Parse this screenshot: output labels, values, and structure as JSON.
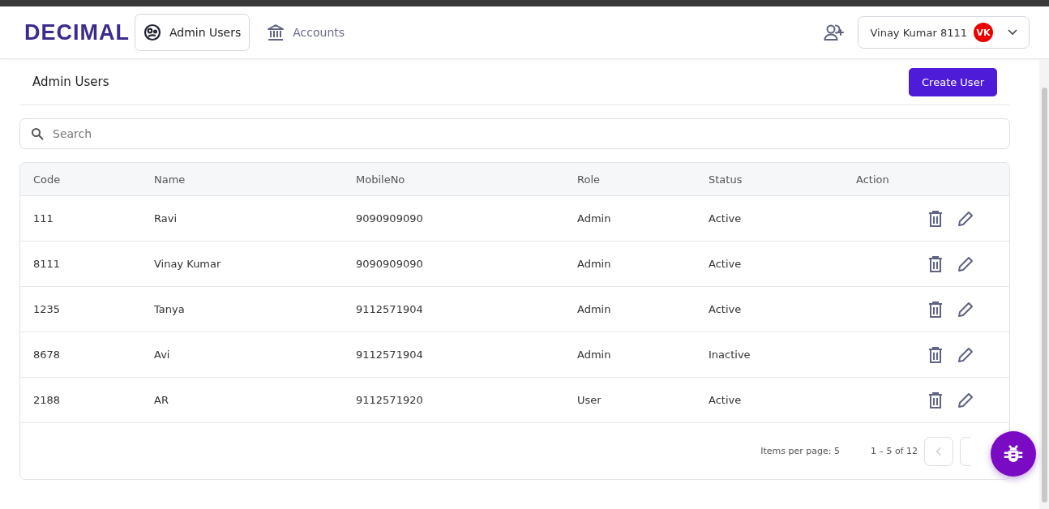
{
  "header": {
    "logo": "DECIMAL",
    "nav": [
      {
        "label": "Admin Users",
        "selected": true
      },
      {
        "label": "Accounts",
        "selected": false
      }
    ],
    "user": {
      "name": "Vinay Kumar 8111",
      "initials": "VK"
    }
  },
  "page": {
    "title": "Admin Users",
    "create_button": "Create User"
  },
  "search": {
    "placeholder": "Search"
  },
  "table": {
    "columns": [
      "Code",
      "Name",
      "MobileNo",
      "Role",
      "Status",
      "Action"
    ],
    "rows": [
      {
        "cells": [
          "111",
          "Ravi",
          "9090909090",
          "Admin",
          "Active"
        ]
      },
      {
        "cells": [
          "8111",
          "Vinay Kumar",
          "9090909090",
          "Admin",
          "Active"
        ]
      },
      {
        "cells": [
          "1235",
          "Tanya",
          "9112571904",
          "Admin",
          "Active"
        ]
      },
      {
        "cells": [
          "8678",
          "Avi",
          "9112571904",
          "Admin",
          "Inactive"
        ]
      },
      {
        "cells": [
          "2188",
          "AR",
          "9112571920",
          "User",
          "Active"
        ]
      }
    ]
  },
  "paginator": {
    "items_per_page": "Items per page: 5",
    "range": "1 – 5 of 12",
    "prev_disabled": true
  }
}
